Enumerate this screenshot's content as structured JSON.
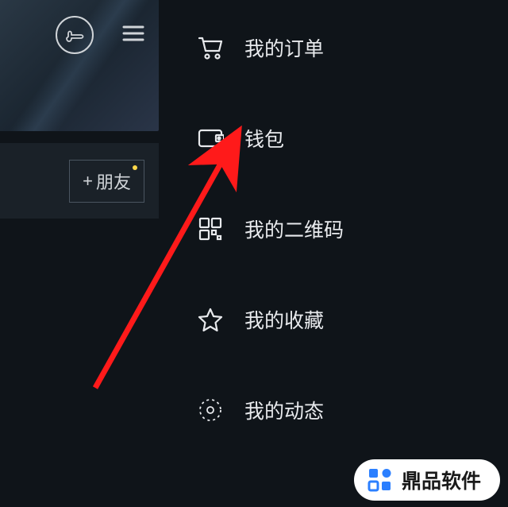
{
  "top": {
    "pointer_icon": "pointing-hand",
    "menu_icon": "hamburger"
  },
  "friend": {
    "plus": "+",
    "label": "朋友",
    "has_dot": true
  },
  "menu": {
    "items": [
      {
        "icon": "cart",
        "label": "我的订单"
      },
      {
        "icon": "wallet",
        "label": "钱包"
      },
      {
        "icon": "qrcode",
        "label": "我的二维码"
      },
      {
        "icon": "star",
        "label": "我的收藏"
      },
      {
        "icon": "activity",
        "label": "我的动态"
      }
    ]
  },
  "annotation": {
    "arrow_color": "#ff1a1a",
    "target_index": 1
  },
  "watermark": {
    "brand_color": "#2b7fff",
    "text": "鼎品软件"
  }
}
